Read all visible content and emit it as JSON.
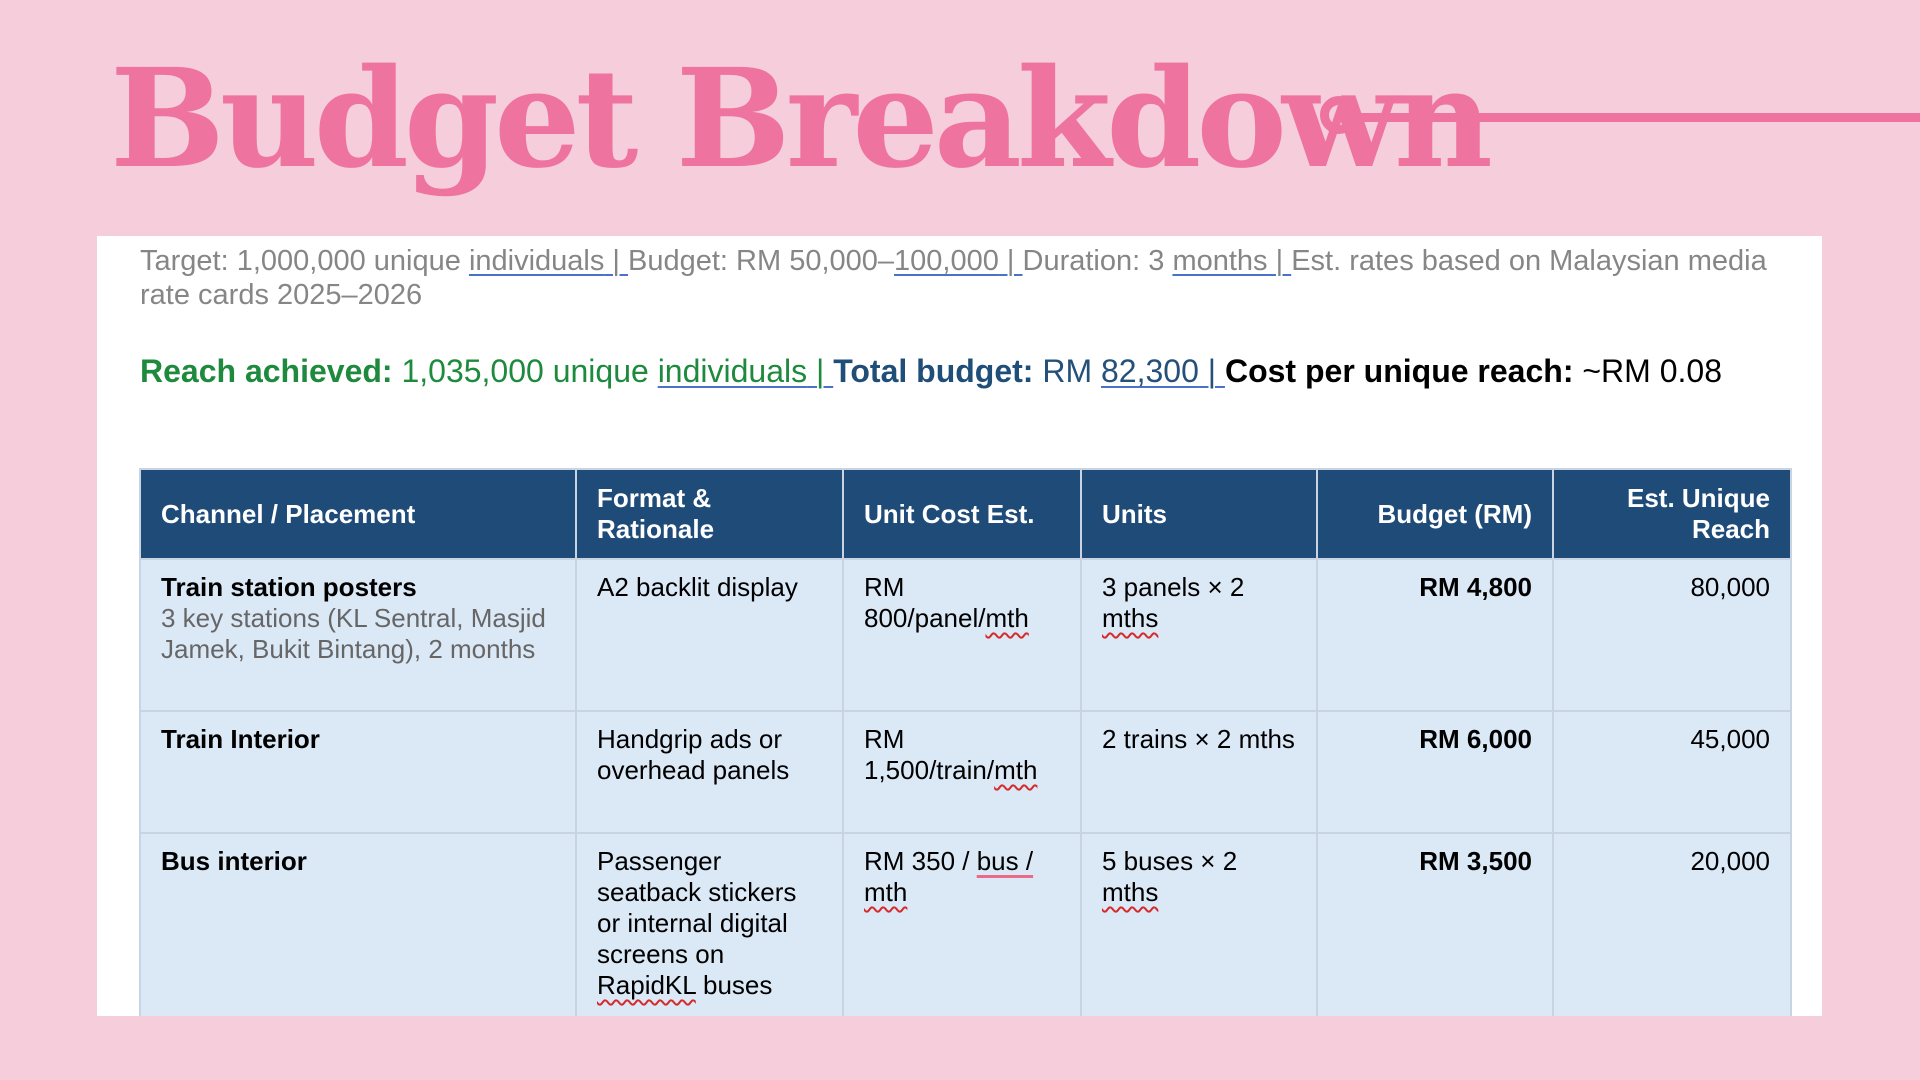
{
  "title": "Budget Breakdown",
  "intro": {
    "target_prefix": "Target: 1,000,000 unique ",
    "target_word": "individuals",
    "sep": " | ",
    "budget_prefix": "Budget: RM 50,000–",
    "budget_upper": "100,000",
    "duration_prefix": "Duration: 3 ",
    "duration_word": "months",
    "rates_note": "Est. rates based on Malaysian media rate cards 2025–2026"
  },
  "summary": {
    "reach_label": "Reach achieved:",
    "reach_prefix": " 1,035,000 unique ",
    "reach_word": "individuals",
    "sep": " | ",
    "budget_label": "Total budget:",
    "budget_prefix": " RM ",
    "budget_value": "82,300",
    "cpr_label": "Cost per unique reach:",
    "cpr_value": " ~RM 0.08"
  },
  "table": {
    "headers": [
      "Channel / Placement",
      "Format & Rationale",
      "Unit Cost Est.",
      "Units",
      "Budget (RM)",
      "Est. Unique Reach"
    ],
    "rows": [
      {
        "channel": "Train station posters",
        "channel_desc": "3 key stations (KL Sentral, Masjid Jamek, Bukit Bintang), 2 months",
        "format": "A2 backlit display",
        "unit_cost_prefix": "RM 800/panel/",
        "unit_cost_flag": "mth",
        "units_prefix": "3 panels × 2 ",
        "units_flag": "mths",
        "budget": "RM 4,800",
        "reach": "80,000"
      },
      {
        "channel": "Train Interior",
        "format": "Handgrip ads or overhead panels",
        "unit_cost_prefix": "RM 1,500/train/",
        "unit_cost_flag": "mth",
        "units": "2 trains × 2 mths",
        "budget": "RM 6,000",
        "reach": "45,000"
      },
      {
        "channel": "Bus interior",
        "format_prefix": "Passenger seatback stickers or internal digital screens on ",
        "format_flag": "RapidKL",
        "format_suffix": " buses",
        "unit_cost_prefix": "RM 350 / ",
        "unit_cost_mid": "bus /",
        "unit_cost_space": " ",
        "unit_cost_flag": "mth",
        "units_prefix": "5 buses × 2 ",
        "units_flag": "mths",
        "budget": "RM 3,500",
        "reach": "20,000"
      }
    ]
  },
  "colors": {
    "background": "#f5cddb",
    "accent_pink": "#ee739f",
    "header_navy": "#1f4b79",
    "cell_blue": "#dbe8f6",
    "reach_green": "#1e8a3d"
  }
}
